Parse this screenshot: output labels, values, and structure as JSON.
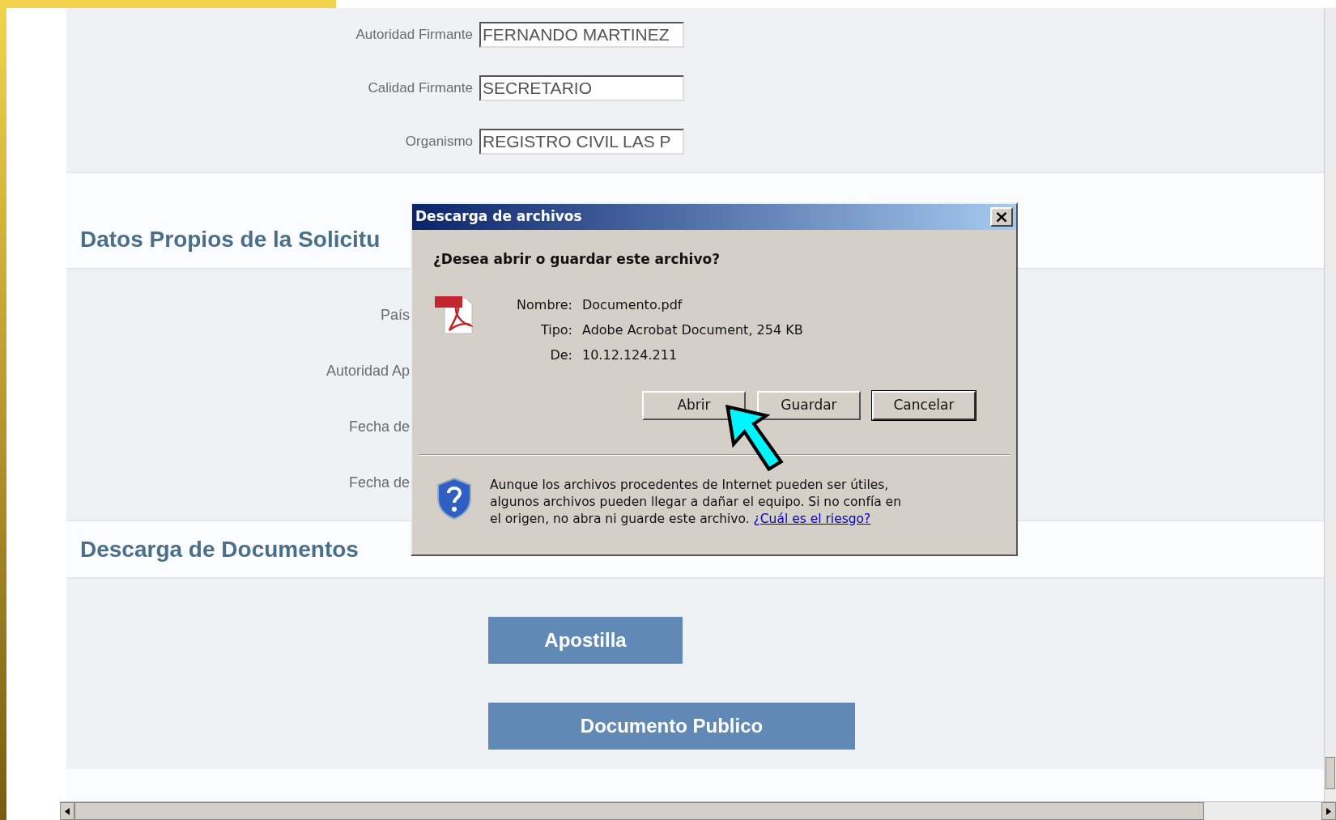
{
  "signer_fields": [
    {
      "label": "Autoridad Firmante",
      "value": "FERNANDO MARTINEZ"
    },
    {
      "label": "Calidad Firmante",
      "value": "SECRETARIO"
    },
    {
      "label": "Organismo",
      "value": "REGISTRO CIVIL LAS P"
    }
  ],
  "request_section": {
    "title": "Datos Propios de la Solicitu",
    "labels": [
      "País",
      "Autoridad Ap",
      "Fecha de",
      "Fecha de"
    ]
  },
  "downloads_section": {
    "title": "Descarga de Documentos",
    "buttons": [
      "Apostilla",
      "Documento Publico"
    ]
  },
  "dialog": {
    "title": "Descarga de archivos",
    "close": "×",
    "question": "¿Desea abrir o guardar este archivo?",
    "details": [
      {
        "label": "Nombre:",
        "value": "Documento.pdf"
      },
      {
        "label": "Tipo:",
        "value": "Adobe Acrobat Document, 254 KB"
      },
      {
        "label": "De:",
        "value": "10.12.124.211"
      }
    ],
    "buttons": [
      {
        "label": "Abrir",
        "default": false
      },
      {
        "label": "Guardar",
        "default": false
      },
      {
        "label": "Cancelar",
        "default": true
      }
    ],
    "warning": "Aunque los archivos procedentes de Internet pueden ser útiles, algunos archivos pueden llegar a dañar el equipo. Si no confía en el origen, no abra ni guarde este archivo.",
    "warning_link": "¿Cuál es el riesgo?"
  }
}
